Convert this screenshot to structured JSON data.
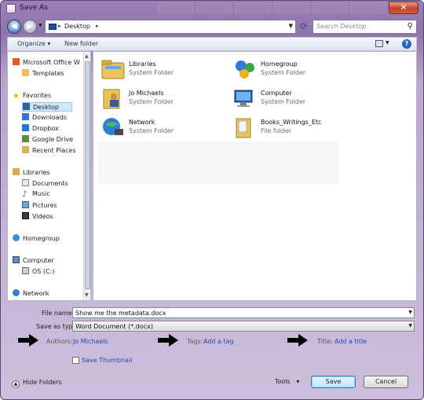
{
  "window": {
    "title": "Save As"
  },
  "address": {
    "path": "Desktop",
    "search_placeholder": "Search Desktop"
  },
  "toolbar": {
    "organize": "Organize",
    "new_folder": "New folder"
  },
  "nav_pane": {
    "items": [
      {
        "label": "Microsoft Office W",
        "icon": "office-icon"
      },
      {
        "label": "Templates",
        "icon": "folder-icon"
      },
      {
        "label": "Favorites",
        "icon": "star-icon"
      },
      {
        "label": "Desktop",
        "icon": "desktop-icon",
        "selected": true
      },
      {
        "label": "Downloads",
        "icon": "downloads-icon"
      },
      {
        "label": "Dropbox",
        "icon": "dropbox-icon"
      },
      {
        "label": "Google Drive",
        "icon": "google-drive-icon"
      },
      {
        "label": "Recent Places",
        "icon": "recent-places-icon"
      },
      {
        "label": "Libraries",
        "icon": "libraries-icon"
      },
      {
        "label": "Documents",
        "icon": "documents-icon"
      },
      {
        "label": "Music",
        "icon": "music-icon"
      },
      {
        "label": "Pictures",
        "icon": "pictures-icon"
      },
      {
        "label": "Videos",
        "icon": "videos-icon"
      },
      {
        "label": "Homegroup",
        "icon": "homegroup-icon"
      },
      {
        "label": "Computer",
        "icon": "computer-icon"
      },
      {
        "label": "OS (C:)",
        "icon": "drive-icon"
      },
      {
        "label": "Network",
        "icon": "network-icon"
      }
    ]
  },
  "content": {
    "items": [
      {
        "name": "Libraries",
        "type": "System Folder",
        "icon": "libraries-icon"
      },
      {
        "name": "Homegroup",
        "type": "System Folder",
        "icon": "homegroup-icon"
      },
      {
        "name": "Jo Michaels",
        "type": "System Folder",
        "icon": "user-folder-icon"
      },
      {
        "name": "Computer",
        "type": "System Folder",
        "icon": "computer-icon"
      },
      {
        "name": "Network",
        "type": "System Folder",
        "icon": "network-icon"
      },
      {
        "name": "Books_Writings_Etc",
        "type": "File folder",
        "icon": "folder-icon"
      }
    ]
  },
  "form": {
    "file_name_label": "File name:",
    "file_name_value": "Show me the metadata.docx",
    "save_type_label": "Save as type:",
    "save_type_value": "Word Document (*.docx)",
    "authors_label": "Authors:",
    "authors_value": "Jo Michaels",
    "tags_label": "Tags:",
    "tags_value": "Add a tag",
    "title_label": "Title:",
    "title_value": "Add a title",
    "thumbnail_label": "Save Thumbnail"
  },
  "footer": {
    "hide_folders": "Hide Folders",
    "tools": "Tools",
    "save": "Save",
    "cancel": "Cancel"
  },
  "colors": {
    "accent": "#1c4fb0",
    "title_bar": "#9b7fb6",
    "selection": "#cde8ff"
  }
}
